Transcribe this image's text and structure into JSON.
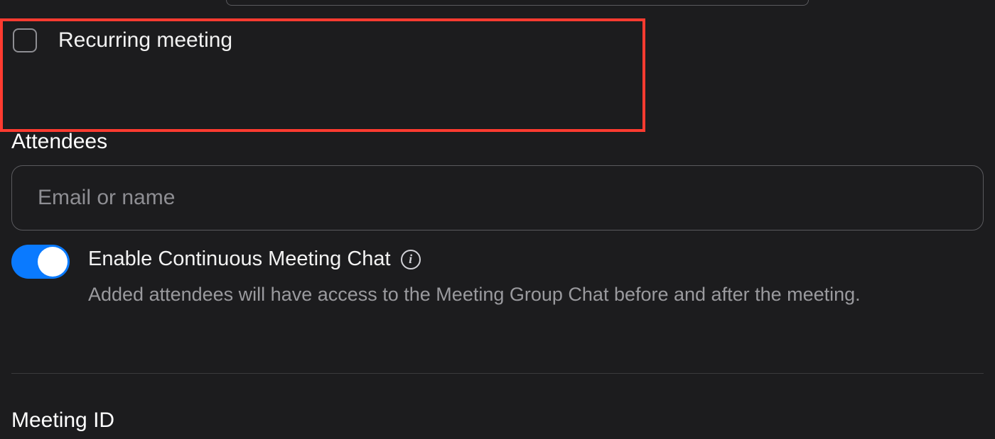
{
  "recurring": {
    "label": "Recurring meeting",
    "checked": false
  },
  "attendees": {
    "heading": "Attendees",
    "placeholder": "Email or name"
  },
  "continuousChat": {
    "label": "Enable Continuous Meeting Chat",
    "description": "Added attendees will have access to the Meeting Group Chat before and after the meeting.",
    "enabled": true
  },
  "meetingId": {
    "heading": "Meeting ID"
  }
}
